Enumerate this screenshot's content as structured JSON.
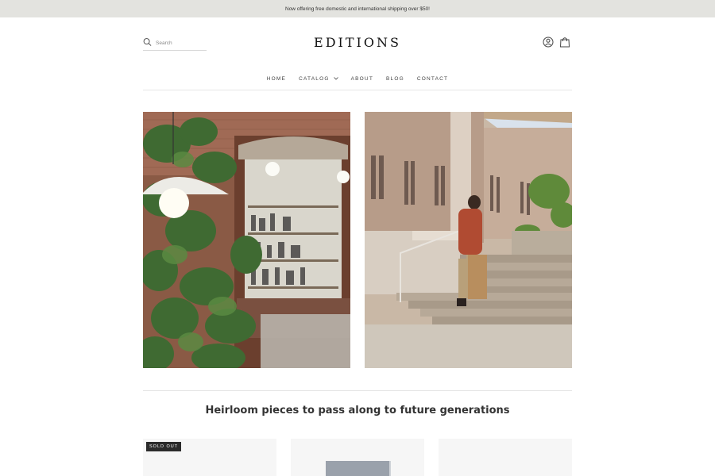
{
  "announcement": "Now offering free domestic and international shipping over $50!",
  "search": {
    "placeholder": "Search"
  },
  "brand": {
    "logo": "EDITIONS"
  },
  "header_icons": {
    "account": "account-icon",
    "cart": "cart-icon"
  },
  "nav": {
    "items": [
      {
        "label": "HOME"
      },
      {
        "label": "CATALOG",
        "has_dropdown": true
      },
      {
        "label": "ABOUT"
      },
      {
        "label": "BLOG"
      },
      {
        "label": "CONTACT"
      }
    ]
  },
  "hero_images": {
    "left": "shop-interior-with-plants-and-pendant-lamp",
    "right": "person-walking-up-stone-steps-with-paper-bag"
  },
  "section": {
    "tagline": "Heirloom pieces to pass along to future generations"
  },
  "products": [
    {
      "badge": "SOLD OUT"
    },
    {
      "badge": ""
    },
    {
      "badge": ""
    }
  ],
  "colors": {
    "announcement_bg": "#e3e3df",
    "text": "#333333",
    "badge_bg": "#2b2b2b"
  }
}
